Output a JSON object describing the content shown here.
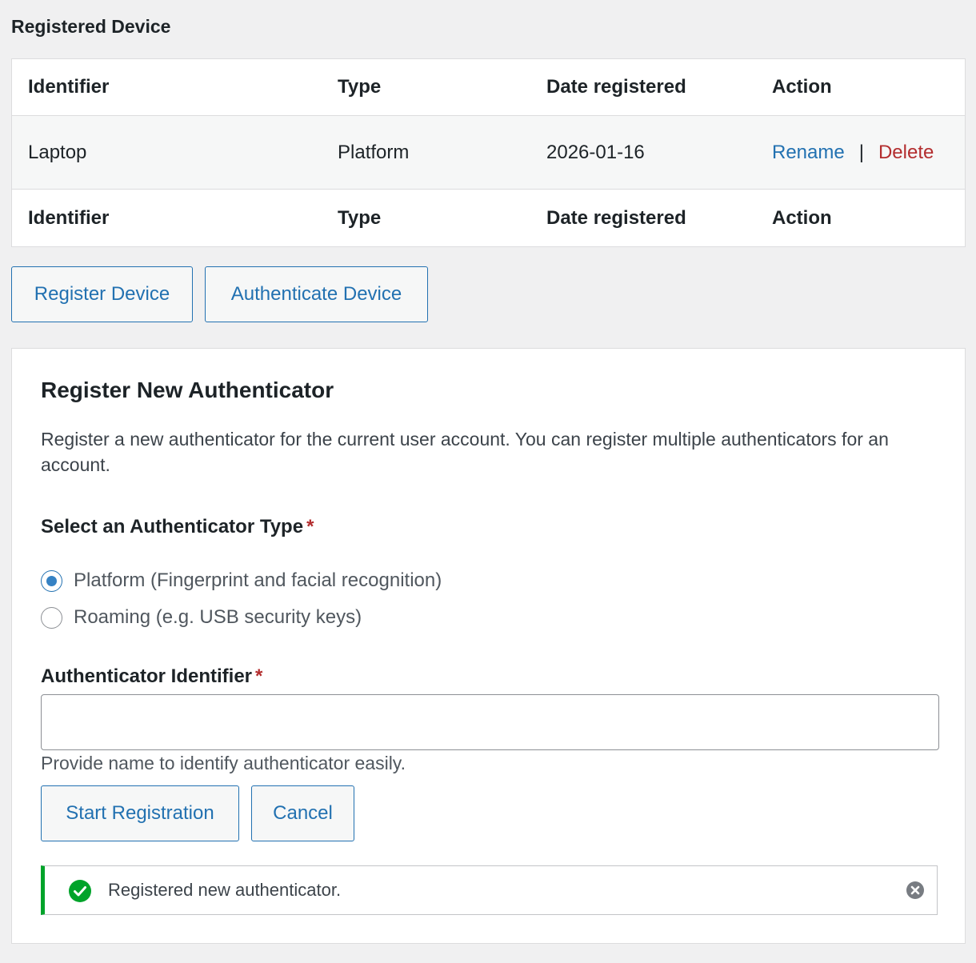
{
  "registered_device": {
    "title": "Registered Device",
    "columns": [
      "Identifier",
      "Type",
      "Date registered",
      "Action"
    ],
    "rows": [
      {
        "identifier": "Laptop",
        "type": "Platform",
        "date": "2026-01-16",
        "rename": "Rename",
        "separator": "|",
        "delete": "Delete"
      }
    ],
    "footer_columns": [
      "Identifier",
      "Type",
      "Date registered",
      "Action"
    ]
  },
  "actions": {
    "register_device": "Register Device",
    "authenticate_device": "Authenticate Device"
  },
  "register_panel": {
    "title": "Register New Authenticator",
    "description": "Register a new authenticator for the current user account. You can register multiple authenticators for an account.",
    "type_label": "Select an Authenticator Type",
    "required_mark": "*",
    "options": [
      {
        "label": "Platform (Fingerprint and facial recognition)",
        "checked": true
      },
      {
        "label": "Roaming (e.g. USB security keys)",
        "checked": false
      }
    ],
    "identifier_label": "Authenticator Identifier",
    "identifier_value": "",
    "identifier_help": "Provide name to identify authenticator easily.",
    "start_button": "Start Registration",
    "cancel_button": "Cancel",
    "notice": {
      "text": "Registered new authenticator.",
      "status": "success",
      "status_color": "#00a32a"
    }
  },
  "colors": {
    "accent": "#2271b1",
    "danger": "#b32d2e",
    "success": "#00a32a",
    "background": "#f0f0f1"
  }
}
